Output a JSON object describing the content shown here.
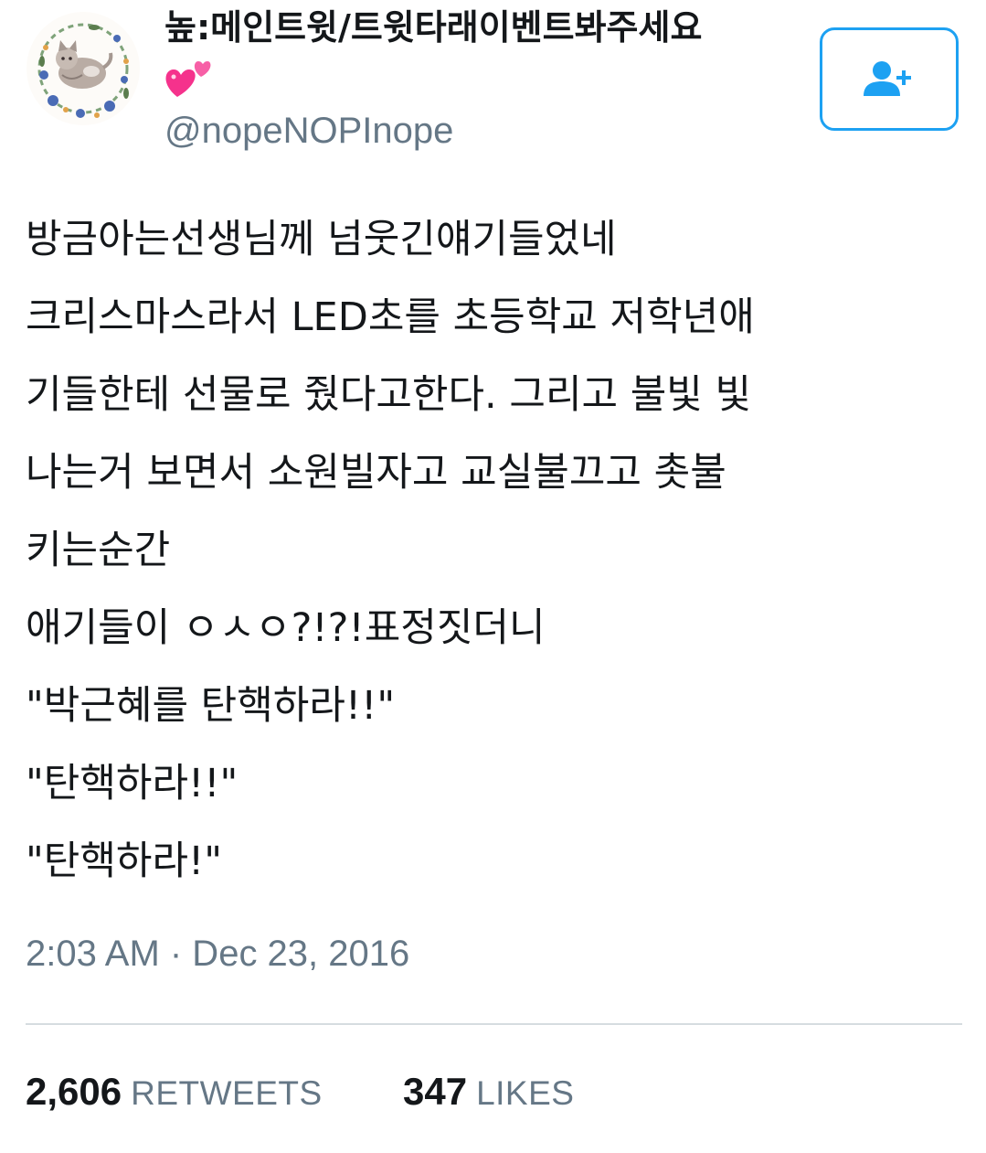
{
  "author": {
    "display_name": "높:메인트윗/트윗타래이벤트봐주세요",
    "username": "@nopeNOPInope",
    "emoji_icon": "two-hearts-icon",
    "avatar_icon": "cat-wreath-avatar"
  },
  "follow_button": {
    "icon": "add-user-icon",
    "accent_color": "#1da1f2"
  },
  "tweet": {
    "lines": [
      "방금아는선생님께 넘웃긴얘기들었네",
      "크리스마스라서 LED초를 초등학교 저학년애",
      "기들한테 선물로 줬다고한다. 그리고 불빛 빛",
      "나는거 보면서 소원빌자고 교실불끄고 촛불",
      "키는순간",
      "애기들이 ㅇㅅㅇ?!?!표정짓더니",
      "\"박근혜를 탄핵하라!!\"",
      "\"탄핵하라!!\"",
      "\"탄핵하라!\""
    ],
    "timestamp": "2:03 AM · Dec 23, 2016"
  },
  "stats": {
    "retweets_count": "2,606",
    "retweets_label": "RETWEETS",
    "likes_count": "347",
    "likes_label": "LIKES"
  }
}
